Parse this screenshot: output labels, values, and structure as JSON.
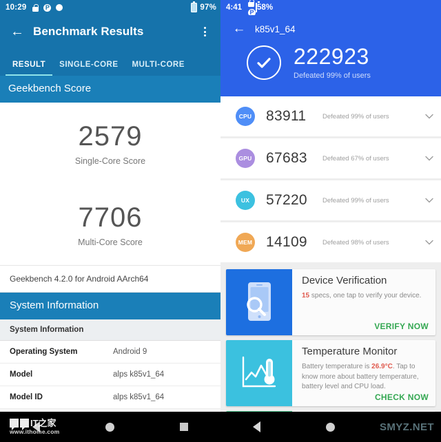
{
  "left_phone": {
    "status_bar": {
      "time": "10:29",
      "icons": [
        "lock-icon",
        "p-icon",
        "dot-icon"
      ],
      "battery_percent": "97%",
      "battery_icon": "battery-icon"
    },
    "app_bar": {
      "back_icon": "back-arrow-icon",
      "title": "Benchmark Results",
      "overflow_icon": "overflow-menu-icon"
    },
    "tabs": [
      {
        "label": "RESULT",
        "active": true
      },
      {
        "label": "SINGLE-CORE",
        "active": false
      },
      {
        "label": "MULTI-CORE",
        "active": false
      }
    ],
    "score_section_title": "Geekbench Score",
    "scores": [
      {
        "value": "2579",
        "label": "Single-Core Score"
      },
      {
        "value": "7706",
        "label": "Multi-Core Score"
      }
    ],
    "version_line": "Geekbench 4.2.0 for Android AArch64",
    "system_section_title": "System Information",
    "system_table": {
      "subheader": "System Information",
      "rows": [
        {
          "key": "Operating System",
          "value": "Android 9"
        },
        {
          "key": "Model",
          "value": "alps k85v1_64"
        },
        {
          "key": "Model ID",
          "value": "alps k85v1_64"
        }
      ]
    },
    "nav_bar": {
      "back": "nav-back-icon",
      "home": "nav-home-icon",
      "recents": "nav-recents-icon"
    },
    "watermark": {
      "logo_text": "IT之家",
      "url": "www.ithome.com"
    }
  },
  "right_phone": {
    "status_bar": {
      "time": "4:41",
      "icons": [
        "lock-icon",
        "p-icon",
        "dot-icon"
      ],
      "battery_percent": "58%",
      "battery_icon": "battery-icon"
    },
    "app_bar": {
      "back_icon": "back-arrow-icon",
      "device_name": "k85v1_64"
    },
    "total": {
      "check_icon": "check-circle-icon",
      "score": "222923",
      "subtitle": "Defeated 99% of users"
    },
    "score_rows": [
      {
        "badge": "CPU",
        "color": "#4f8ef7",
        "value": "83911",
        "defeated": "Defeated 99% of users",
        "chevron": "chevron-down-icon"
      },
      {
        "badge": "GPU",
        "color": "#ab8ee0",
        "value": "67683",
        "defeated": "Defeated 67% of users",
        "chevron": "chevron-down-icon"
      },
      {
        "badge": "UX",
        "color": "#3cc1e0",
        "value": "57220",
        "defeated": "Defeated 99% of users",
        "chevron": "chevron-down-icon"
      },
      {
        "badge": "MEM",
        "color": "#f0a855",
        "value": "14109",
        "defeated": "Defeated 98% of users",
        "chevron": "chevron-down-icon"
      }
    ],
    "promos": [
      {
        "thumb_color": "#1d6fe0",
        "thumb_icon": "phone-magnifier-icon",
        "title": "Device Verification",
        "body_prefix": "15",
        "body_rest": " specs, one tap to verify your device.",
        "cta": "VERIFY NOW"
      },
      {
        "thumb_color": "#3bc1df",
        "thumb_icon": "thermometer-chart-icon",
        "title": "Temperature Monitor",
        "body_prefix": "Battery temperature is ",
        "body_highlight": "26.9°C",
        "body_rest": ". Tap to know more about battery temperature, battery level and CPU load.",
        "cta": "CHECK NOW"
      }
    ],
    "peek_card": {
      "thumb_color": "#53c38f"
    },
    "nav_bar": {
      "back": "nav-back-icon",
      "home": "nav-home-icon"
    },
    "watermark": {
      "text": "SMYZ.NET"
    }
  }
}
